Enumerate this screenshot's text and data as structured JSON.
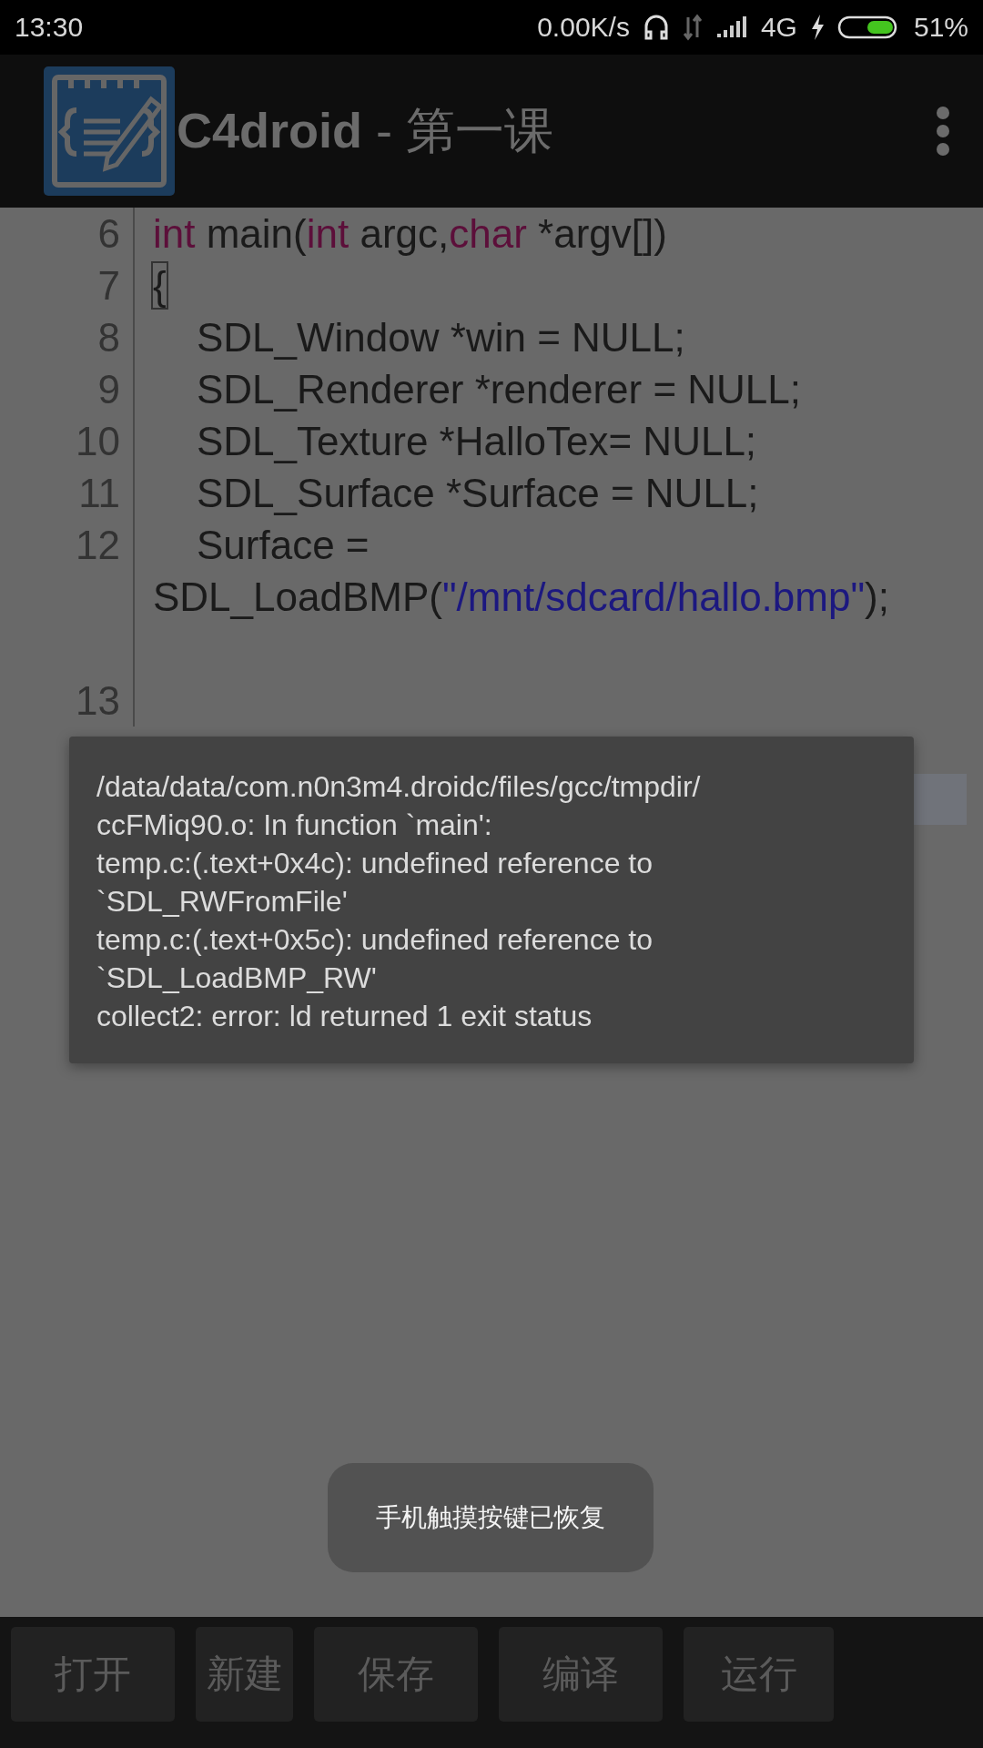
{
  "status_bar": {
    "time": "13:30",
    "speed": "0.00K/s",
    "network": "4G",
    "battery": "51%"
  },
  "app_bar": {
    "title": "**C4droid** - 第一课"
  },
  "editor": {
    "lines": [
      {
        "number": "6",
        "indent": false,
        "tokens": [
          {
            "kind": "keyword",
            "text": "int"
          },
          {
            "kind": "plain",
            "text": " main("
          },
          {
            "kind": "keyword",
            "text": "int"
          },
          {
            "kind": "plain",
            "text": " argc,"
          },
          {
            "kind": "keyword",
            "text": "char"
          },
          {
            "kind": "plain",
            "text": " *argv[])"
          }
        ]
      },
      {
        "number": "7",
        "indent": false,
        "tokens": [
          {
            "kind": "bracket",
            "text": "{"
          }
        ]
      },
      {
        "number": "8",
        "indent": true,
        "tokens": [
          {
            "kind": "plain",
            "text": "SDL_Window *win = NULL;"
          }
        ]
      },
      {
        "number": "9",
        "indent": true,
        "tokens": [
          {
            "kind": "plain",
            "text": "SDL_Renderer *renderer = NULL;"
          }
        ]
      },
      {
        "number": "10",
        "indent": true,
        "tokens": [
          {
            "kind": "plain",
            "text": "SDL_Texture *HalloTex= NULL;"
          }
        ]
      },
      {
        "number": "11",
        "indent": true,
        "tokens": [
          {
            "kind": "plain",
            "text": "SDL_Surface *Surface = NULL;"
          }
        ]
      },
      {
        "number": "12",
        "indent": true,
        "tokens": [
          {
            "kind": "plain",
            "text": "Surface = SDL_LoadBMP("
          },
          {
            "kind": "string",
            "text": "\"/mnt/sdcard/hallo.bmp\""
          },
          {
            "kind": "plain",
            "text": ");"
          }
        ]
      },
      {
        "number": "13"
      }
    ]
  },
  "error_dialog": {
    "lines": [
      "/data/data/com.n0n3m4.droidc/files/gcc/tmpdir/",
      "ccFMiq90.o: In function `main':",
      "temp.c:(.text+0x4c): undefined reference to",
      "`SDL_RWFromFile'",
      "temp.c:(.text+0x5c): undefined reference to",
      "`SDL_LoadBMP_RW'",
      "collect2: error: ld returned 1 exit status"
    ]
  },
  "toast": {
    "text": "手机触摸按键已恢复"
  },
  "toolbar": {
    "buttons": [
      "打开",
      "新建",
      "保存",
      "编译",
      "运行"
    ]
  }
}
